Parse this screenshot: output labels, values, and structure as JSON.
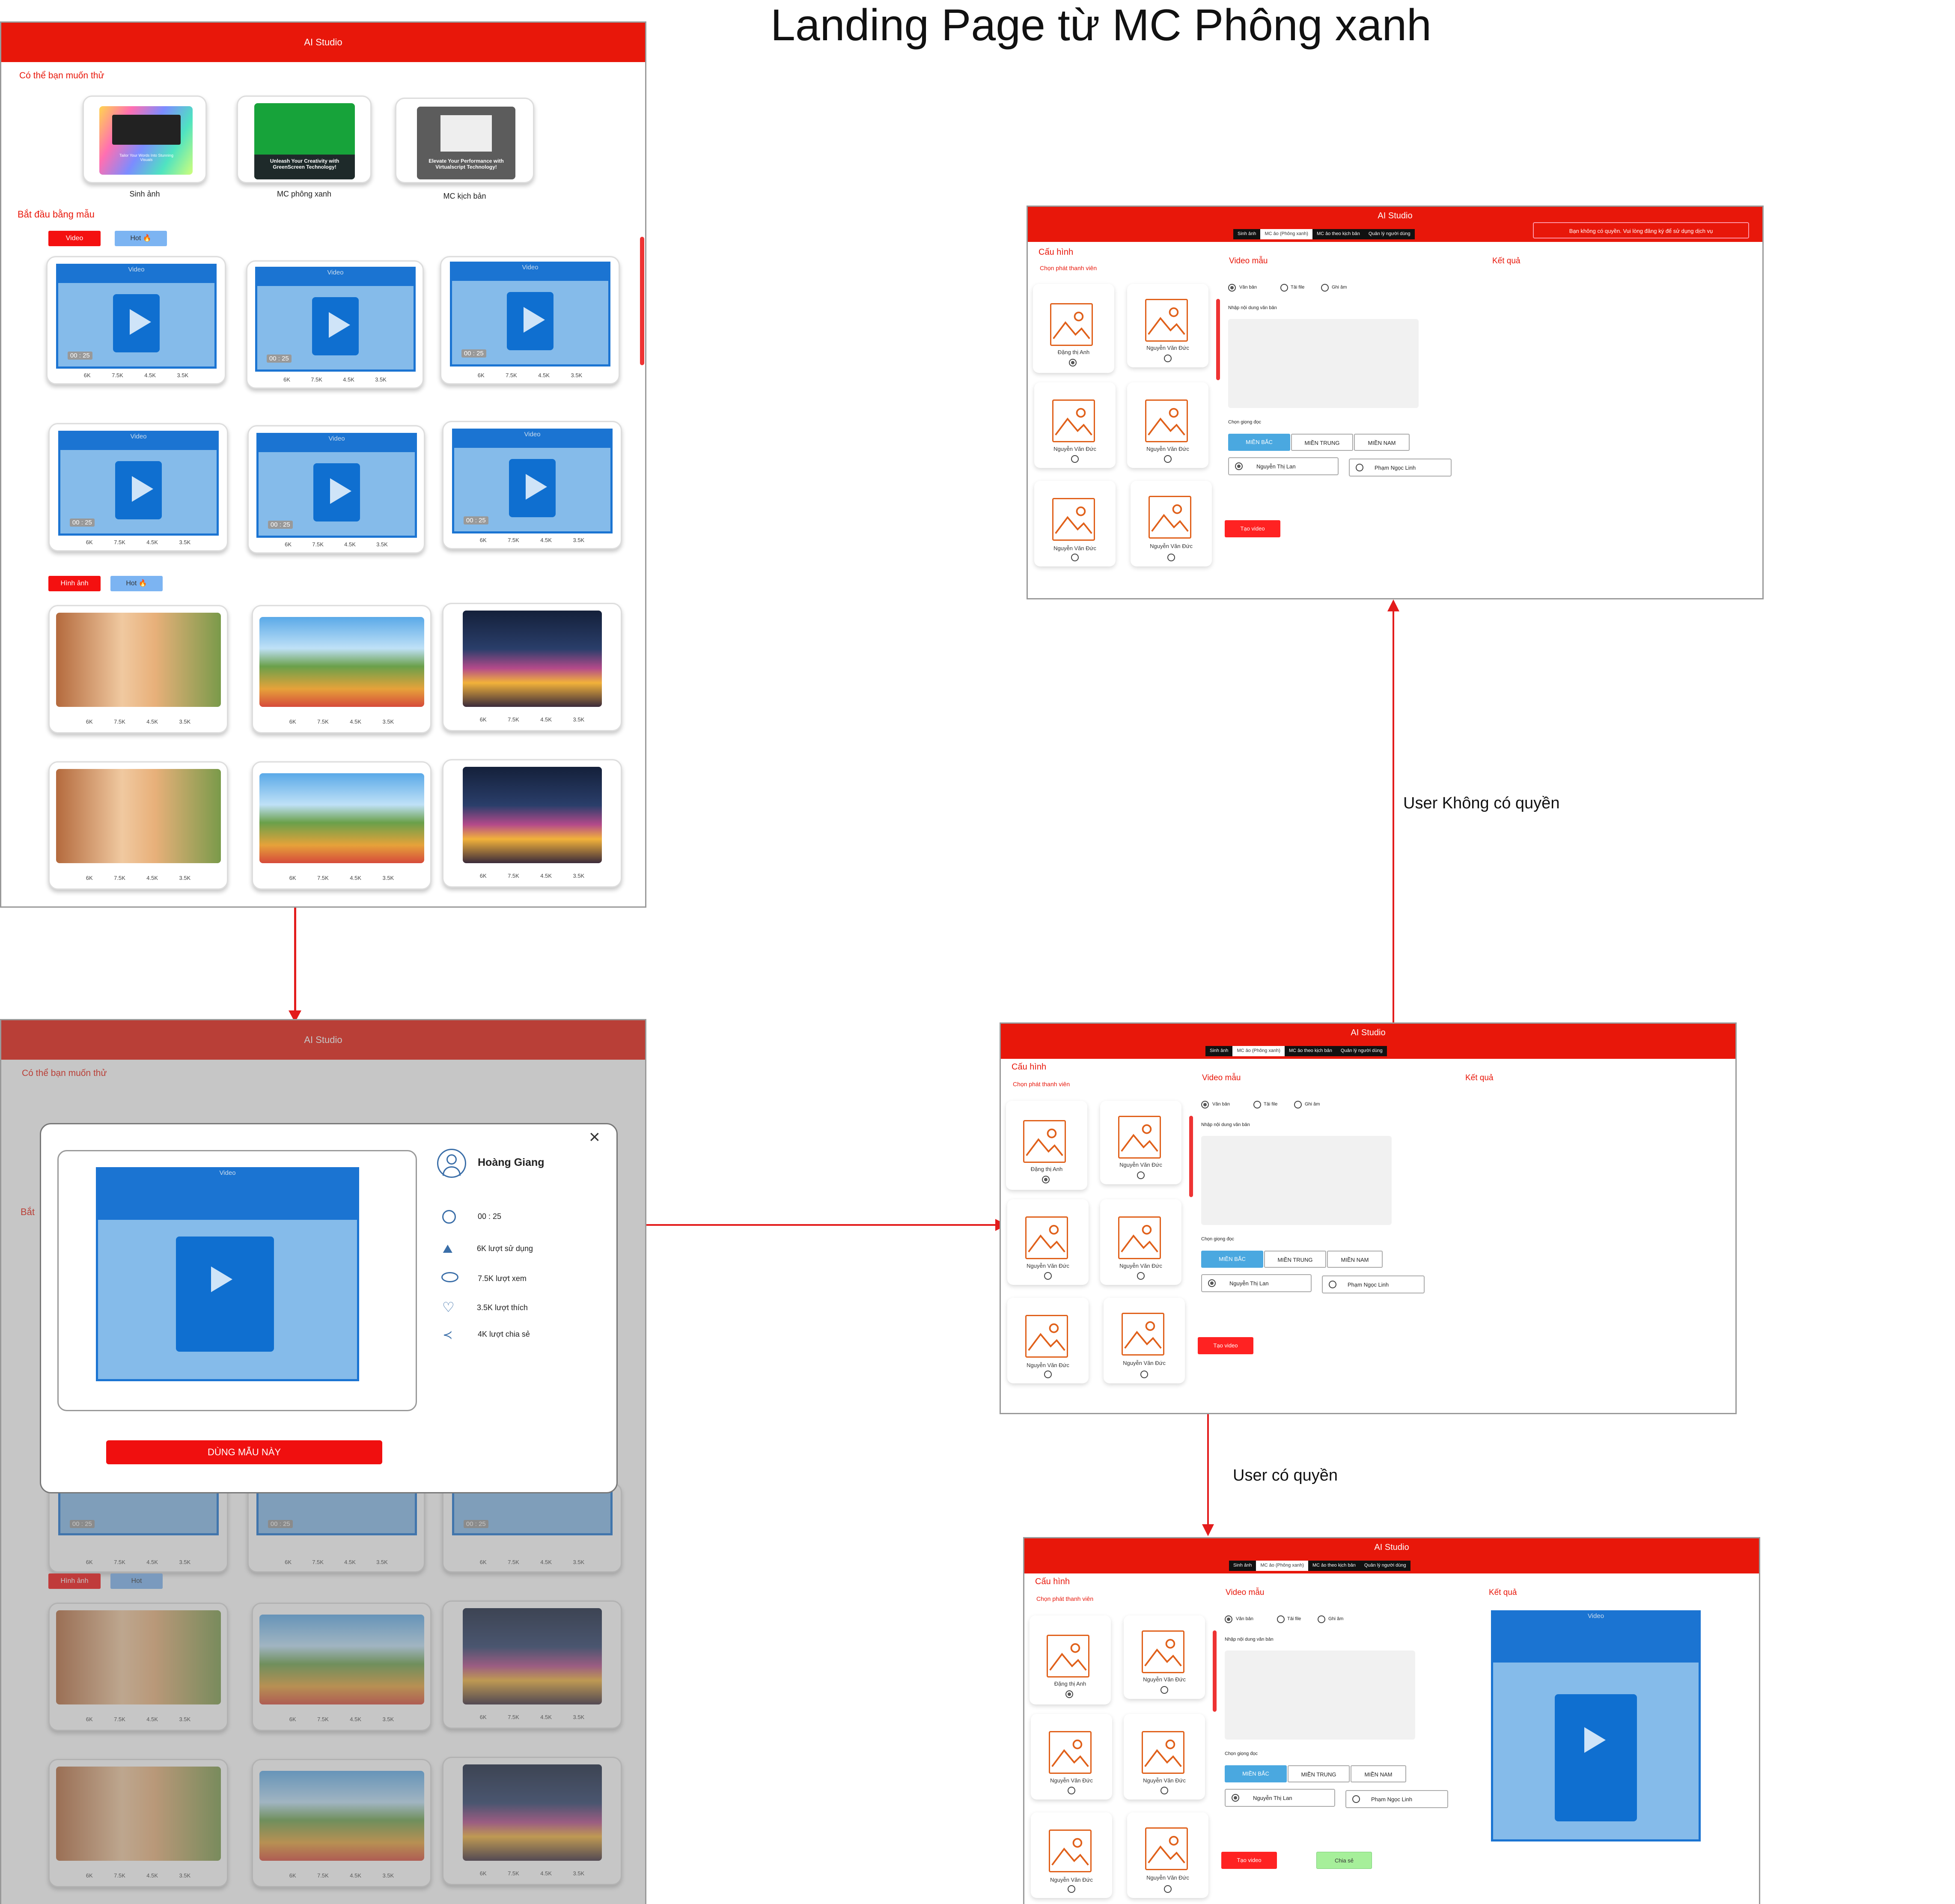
{
  "title": "Landing Page từ MC Phông xanh",
  "app_title": "AI Studio",
  "landing": {
    "section_try": "Có thể bạn muốn thử",
    "features": [
      {
        "label": "Sinh ảnh",
        "thumb_caption": "Tailor Your Words Into Stunning Visuals"
      },
      {
        "label": "MC phông xanh",
        "thumb_caption": "Unleash Your Creativity with GreenScreen Technology!"
      },
      {
        "label": "MC kịch bản",
        "thumb_caption": "Elevate Your Performance with Virtualscript Technology!"
      }
    ],
    "section_start": "Bắt đầu bằng mẫu",
    "tag_video": "Video",
    "tag_image": "Hình ảnh",
    "tag_hot": "Hot",
    "video_bar": "Video",
    "duration": "00 : 25",
    "stats": {
      "uses": "6K",
      "views": "7.5K",
      "likes": "4.5K",
      "shares": "3.5K"
    }
  },
  "modal": {
    "author": "Hoàng Giang",
    "video_bar": "Video",
    "duration": "00 : 25",
    "uses": "6K lượt sử dụng",
    "views": "7.5K lượt xem",
    "likes": "3.5K lượt thích",
    "shares": "4K lượt chia sẻ",
    "use_button": "DÙNG MẪU NÀY",
    "close": "×"
  },
  "studio": {
    "tabs": [
      "Sinh ảnh",
      "MC ảo (Phông xanh)",
      "MC ảo theo kịch bản",
      "Quản lý người dùng"
    ],
    "config_title": "Cấu hình",
    "presenter_label": "Chọn phát thanh viên",
    "presenters": [
      "Đặng thị Anh",
      "Nguyễn Văn Đức",
      "Nguyễn Văn Đức",
      "Nguyễn Văn Đức",
      "Nguyễn Văn Đức",
      "Nguyễn Văn Đức"
    ],
    "video_sample": "Video mẫu",
    "result": "Kết quả",
    "input_modes": [
      "Văn bản",
      "Tải file",
      "Ghi âm"
    ],
    "text_label": "Nhập nội dung văn bản",
    "voice_label": "Chọn giọng đọc",
    "regions": [
      "MIỀN BẮC",
      "MIỀN TRUNG",
      "MIỀN NAM"
    ],
    "voices": [
      "Nguyễn Thị Lan",
      "Phạm Ngọc Linh"
    ],
    "create_button": "Tạo video",
    "share_button": "Chia sẻ",
    "no_permission": "Bạn không có quyền. Vui lòng đăng ký để sử dụng dịch vụ",
    "video_bar": "Video"
  },
  "flow": {
    "no_permission": "User Không có quyền",
    "has_permission": "User có quyền"
  },
  "colors": {
    "brand_red": "#e8170a",
    "video_blue": "#1b74d2",
    "video_light": "#85bbea",
    "region_active": "#4aa8e0",
    "share_green": "#a6ef9a"
  }
}
